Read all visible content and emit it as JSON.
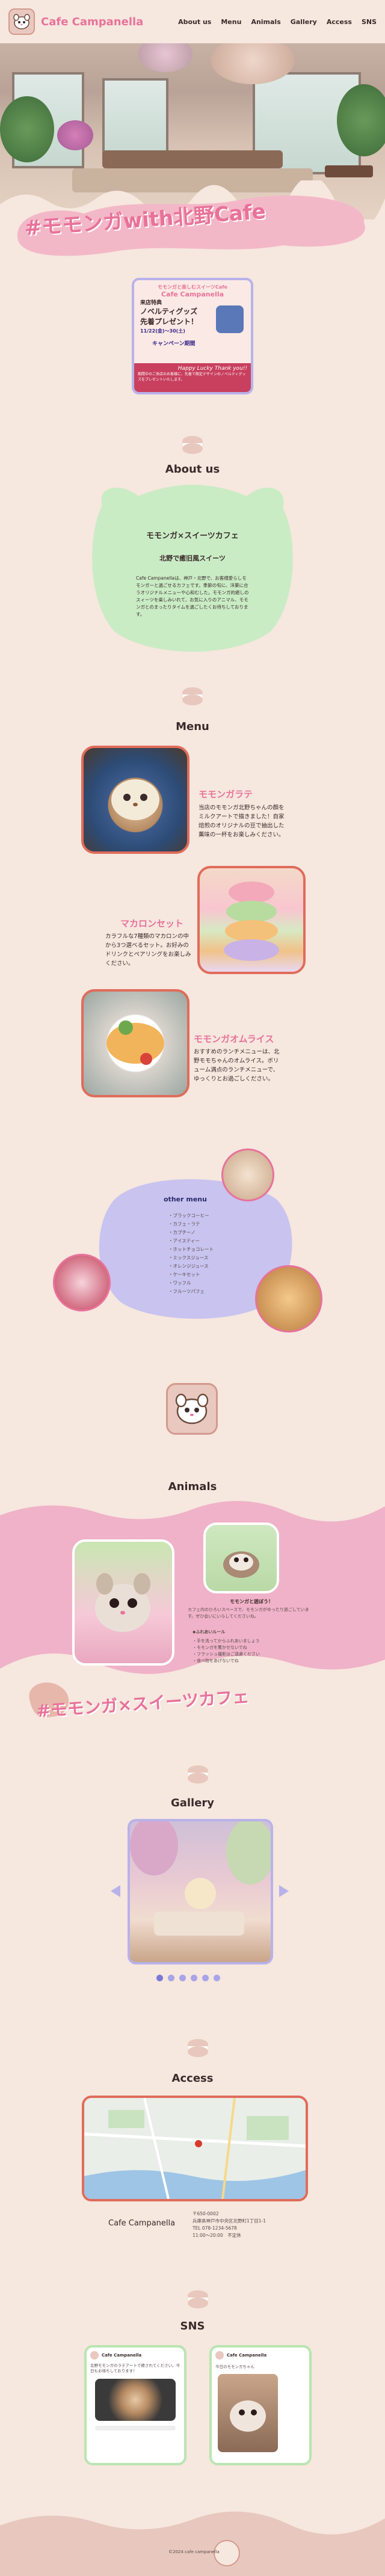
{
  "header": {
    "brand": "Cafe Campanella",
    "nav": [
      "About us",
      "Menu",
      "Animals",
      "Gallery",
      "Access",
      "SNS"
    ]
  },
  "hero": {
    "tagline": "#モモンガwith北野Cafe"
  },
  "campaign": {
    "line1": "モモンガと楽しむスイーツCafe",
    "brand": "Cafe Campanella",
    "line2": "来店特典",
    "line3": "ノベルティグッズ",
    "line4": "先着プレゼント！",
    "dates": "11/22(金)〜30(土)",
    "period": "キャンペーン期間",
    "banner": "Happy Lucky Thank you!!",
    "note": "期間中のご来店のお客様に、先着で限定デザインのノベルティグッズをプレゼントいたします。"
  },
  "about": {
    "title": "About us",
    "heading": "モモンガ×スイーツカフェ",
    "subheading": "北野で癒旧風スイーツ",
    "body": "Cafe Campanellaは、神戸・北野で、お客様愛らしモモンガーと過ごせるカフェです。季節の旬に、洋菓に合うオリジナルメニューや心和むした。モモンガ的癒しのスィーツを楽しみいれて、お気に入りのアニマル、モモンガとのまったりタイムを過ごしたくお待ちしております。"
  },
  "menu": {
    "title": "Menu",
    "items": [
      {
        "name": "モモンガラテ",
        "desc": "当店のモモンガ北野ちゃんの顔をミルクアートで描きました！自家焙煎のオリジナルの豆で抽出した薫味の一杯をお楽しみください。"
      },
      {
        "name": "マカロンセット",
        "desc": "カラフルな7種類のマカロンの中から3つ選べるセット。お好みのドリンクとペアリングをお楽しみください。"
      },
      {
        "name": "モモンガオムライス",
        "desc": "おすすめのランチメニューは、北野モモちゃんのオムライス。ボリューム満点のランチメニューで、ゆっくりとお過ごしください。"
      }
    ],
    "other_title": "other menu",
    "other_items": [
      "・ブラックコーヒー",
      "・カフェ・ラテ",
      "・カプチーノ",
      "・アイスティー",
      "・ホットチョコレート",
      "・ミックスジュース",
      "・オレンジジュース",
      "・ケーキセット",
      "・ワッフル",
      "・フルーツパフェ"
    ]
  },
  "animals": {
    "title": "Animals",
    "caption1": "モモンガと遊ぼう！",
    "caption2": "カフェ内のひろいスペースで、モモンガがゆったり過ごしています。ぜひ会いにいらしてくださいね。",
    "note_title": "◆ふれあいルール",
    "rules": [
      "・手を洗ってからふれあいましょう",
      "・モモンガを驚かせないでね",
      "・フラッシュ撮影はご遠慮ください",
      "・食べ物をあげないでね"
    ],
    "tagline": "#モモンガ×スイーツカフェ"
  },
  "gallery": {
    "title": "Gallery",
    "dots": 6,
    "active": 0
  },
  "access": {
    "title": "Access",
    "name": "Cafe Campanella",
    "address": "〒650-0002\n兵庫県神戸市中央区北野町1丁目1-1\nTEL 078-1234-5678\n11:00〜20:00　不定休"
  },
  "sns": {
    "title": "SNS",
    "tweet1": {
      "user": "Cafe Campanella",
      "text": "北野モモンガのラテアートで癒されてください。今日もお待ちしております！"
    },
    "tweet2": {
      "user": "Cafe Campanella",
      "text": "今日のモモンガちゃん"
    }
  },
  "footer": {
    "copyright": "©2024 cafe campanella"
  },
  "colors": {
    "accent": "#e8729a",
    "background": "#f6e7df",
    "mint": "#c9ecc4",
    "lavender": "#c8c3ef",
    "coral": "#e06c5a",
    "pink": "#f0b2c8"
  }
}
